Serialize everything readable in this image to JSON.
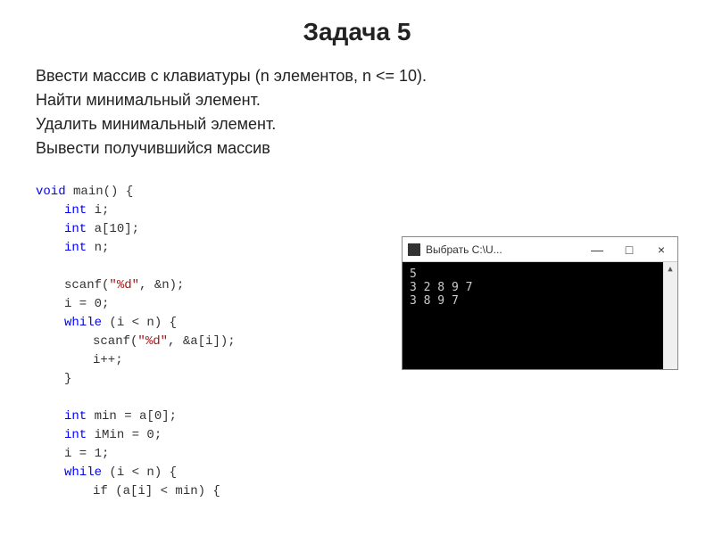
{
  "title": "Задача 5",
  "description": {
    "line1": "Ввести массив с клавиатуры (n элементов, n <= 10).",
    "line2": "Найти минимальный элемент.",
    "line3": "Удалить минимальный элемент.",
    "line4": "Вывести получившийся массив"
  },
  "code": {
    "l1a": "void",
    "l1b": " main() {",
    "l2a": "int",
    "l2b": " i;",
    "l3a": "int",
    "l3b": " a[10];",
    "l4a": "int",
    "l4b": " n;",
    "l5a": "scanf(",
    "l5b": "\"%d\"",
    "l5c": ", &n);",
    "l6": "i = 0;",
    "l7a": "while",
    "l7b": " (i < n) {",
    "l8a": "scanf(",
    "l8b": "\"%d\"",
    "l8c": ", &a[i]);",
    "l9": "i++;",
    "l10": "}",
    "l11a": "int",
    "l11b": " min = a[0];",
    "l12a": "int",
    "l12b": " iMin = 0;",
    "l13": "i = 1;",
    "l14a": "while",
    "l14b": " (i < n) {",
    "l15": "if (a[i] < min) {"
  },
  "console": {
    "title": "Выбрать C:\\U...",
    "min": "—",
    "max": "□",
    "close": "×",
    "line1": "5",
    "line2": "3 2 8 9 7",
    "line3": "3 8 9 7"
  }
}
